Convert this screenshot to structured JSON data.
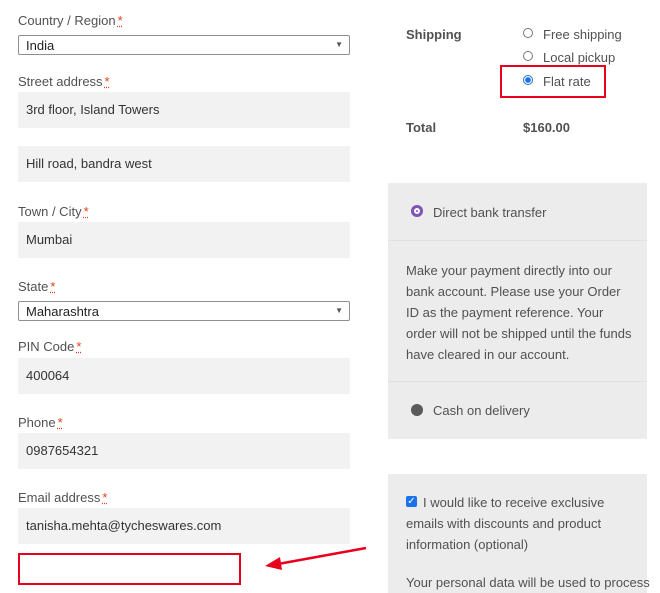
{
  "billing": {
    "country_label": "Country / Region",
    "country_value": "India",
    "street_label": "Street address",
    "street_line1": "3rd floor, Island Towers",
    "street_line2": "Hill road, bandra west",
    "city_label": "Town / City",
    "city_value": "Mumbai",
    "state_label": "State",
    "state_value": "Maharashtra",
    "pin_label": "PIN Code",
    "pin_value": "400064",
    "phone_label": "Phone",
    "phone_value": "0987654321",
    "email_label": "Email address",
    "email_value": "tanisha.mehta@tycheswares.com",
    "required_marker": "*"
  },
  "order": {
    "shipping_label": "Shipping",
    "shipping_options": [
      "Free shipping",
      "Local pickup",
      "Flat rate"
    ],
    "selected_shipping": "Flat rate",
    "total_label": "Total",
    "total_value": "$160.00"
  },
  "payment": {
    "bank_transfer_label": "Direct bank transfer",
    "bank_transfer_desc": "Make your payment directly into our bank account. Please use your Order ID as the payment reference. Your order will not be shipped until the funds have cleared in our account.",
    "cod_label": "Cash on delivery",
    "selected": "Direct bank transfer"
  },
  "consent": {
    "marketing_label": "I would like to receive exclusive emails with discounts and product information (optional)",
    "marketing_checked": true,
    "privacy_text": "Your personal data will be used to process"
  },
  "colors": {
    "annotation_red": "#e8001c",
    "accent_purple": "#7f54b3",
    "radio_blue": "#1a73e8"
  }
}
